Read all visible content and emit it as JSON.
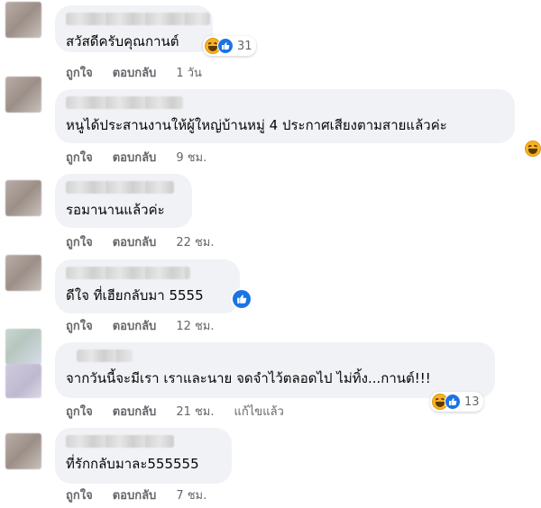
{
  "comments": [
    {
      "text": "สวัสดีครับคุณกานต์",
      "like_label": "ถูกใจ",
      "reply_label": "ตอบกลับ",
      "time": "1 วัน",
      "reactions": [
        "haha-icon",
        "like-icon"
      ],
      "reaction_count": "31"
    },
    {
      "text": "หนูได้ประสานงานให้ผู้ใหญ่บ้านหมู่ 4 ประกาศเสียงตามสายแล้วค่ะ",
      "like_label": "ถูกใจ",
      "reply_label": "ตอบกลับ",
      "time": "9 ชม.",
      "reactions": [
        "haha-icon"
      ]
    },
    {
      "text": "รอมานานแล้วค่ะ",
      "like_label": "ถูกใจ",
      "reply_label": "ตอบกลับ",
      "time": "22 ชม."
    },
    {
      "text": "ดีใจ ที่เฮียกลับมา 5555",
      "like_label": "ถูกใจ",
      "reply_label": "ตอบกลับ",
      "time": "12 ชม.",
      "reactions": [
        "like-icon"
      ]
    },
    {
      "text": "จากวันนี้จะมีเรา เราและนาย จดจำไว้ตลอดไป ไม่ทิ้ง...กานต์!!!",
      "like_label": "ถูกใจ",
      "reply_label": "ตอบกลับ",
      "time": "21 ชม.",
      "edited_label": "แก้ไขแล้ว",
      "reactions": [
        "haha-icon",
        "like-icon"
      ],
      "reaction_count": "13"
    },
    {
      "text": "ที่รักกลับมาละ555555",
      "like_label": "ถูกใจ",
      "reply_label": "ตอบกลับ",
      "time": "7 ชม."
    }
  ],
  "colors": {
    "bubble": "#f0f2f5",
    "meta_text": "#65676b",
    "like_blue": "#1b74e4",
    "haha_yellow": "#f7b125"
  }
}
